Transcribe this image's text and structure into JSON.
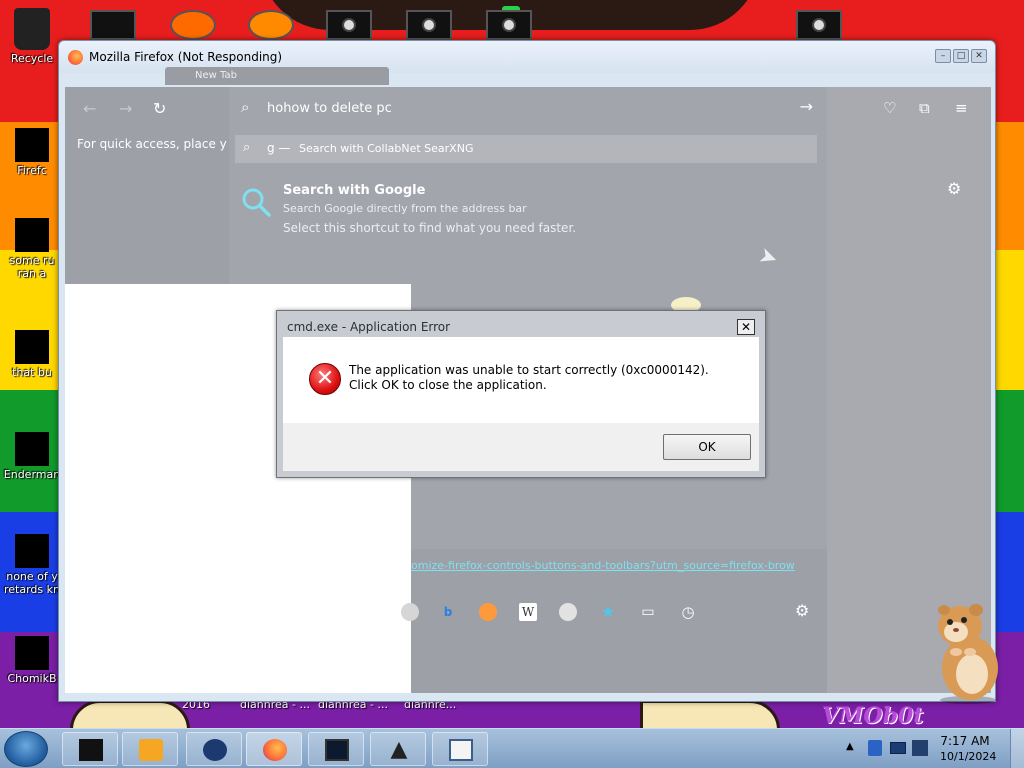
{
  "desktop": {
    "icons": [
      {
        "label": "Recycle"
      },
      {
        "label": "Firefc"
      },
      {
        "label": "some ru ran a"
      },
      {
        "label": "that bu"
      },
      {
        "label": "Enderman"
      },
      {
        "label": "none of y retards kn"
      },
      {
        "label": "ChomikB"
      }
    ],
    "bottom_labels": [
      "2016",
      "diahhrea - ...",
      "diahhrea - ...",
      "diahhre..."
    ],
    "wallpaper_text": "VMOb0t"
  },
  "firefox": {
    "window_title": "Mozilla Firefox (Not Responding)",
    "ghost_tab_label": "New Tab",
    "quick_access": "For quick access, place your b",
    "urlbar": {
      "value": "hohow to delete pc",
      "suggestion_prefix": "g —",
      "suggestion_text": "Search with CollabNet SearXNG"
    },
    "tip": {
      "title": "Search with Google",
      "description": "Search Google directly from the address bar",
      "hint": "Select this shortcut to find what you need faster."
    },
    "link_text": "omize-firefox-controls-buttons-and-toolbars?utm_source=firefox-brow"
  },
  "error_dialog": {
    "title": "cmd.exe - Application Error",
    "message": "The application was unable to start correctly (0xc0000142). Click OK to close the application.",
    "ok_label": "OK",
    "close_label": "✕"
  },
  "taskbar": {
    "time": "7:17 AM",
    "date": "10/1/2024"
  },
  "colors": {
    "error_red": "#d11111",
    "taskbar_blue": "#7e9fc4",
    "link_cyan": "#7fe0ee"
  }
}
